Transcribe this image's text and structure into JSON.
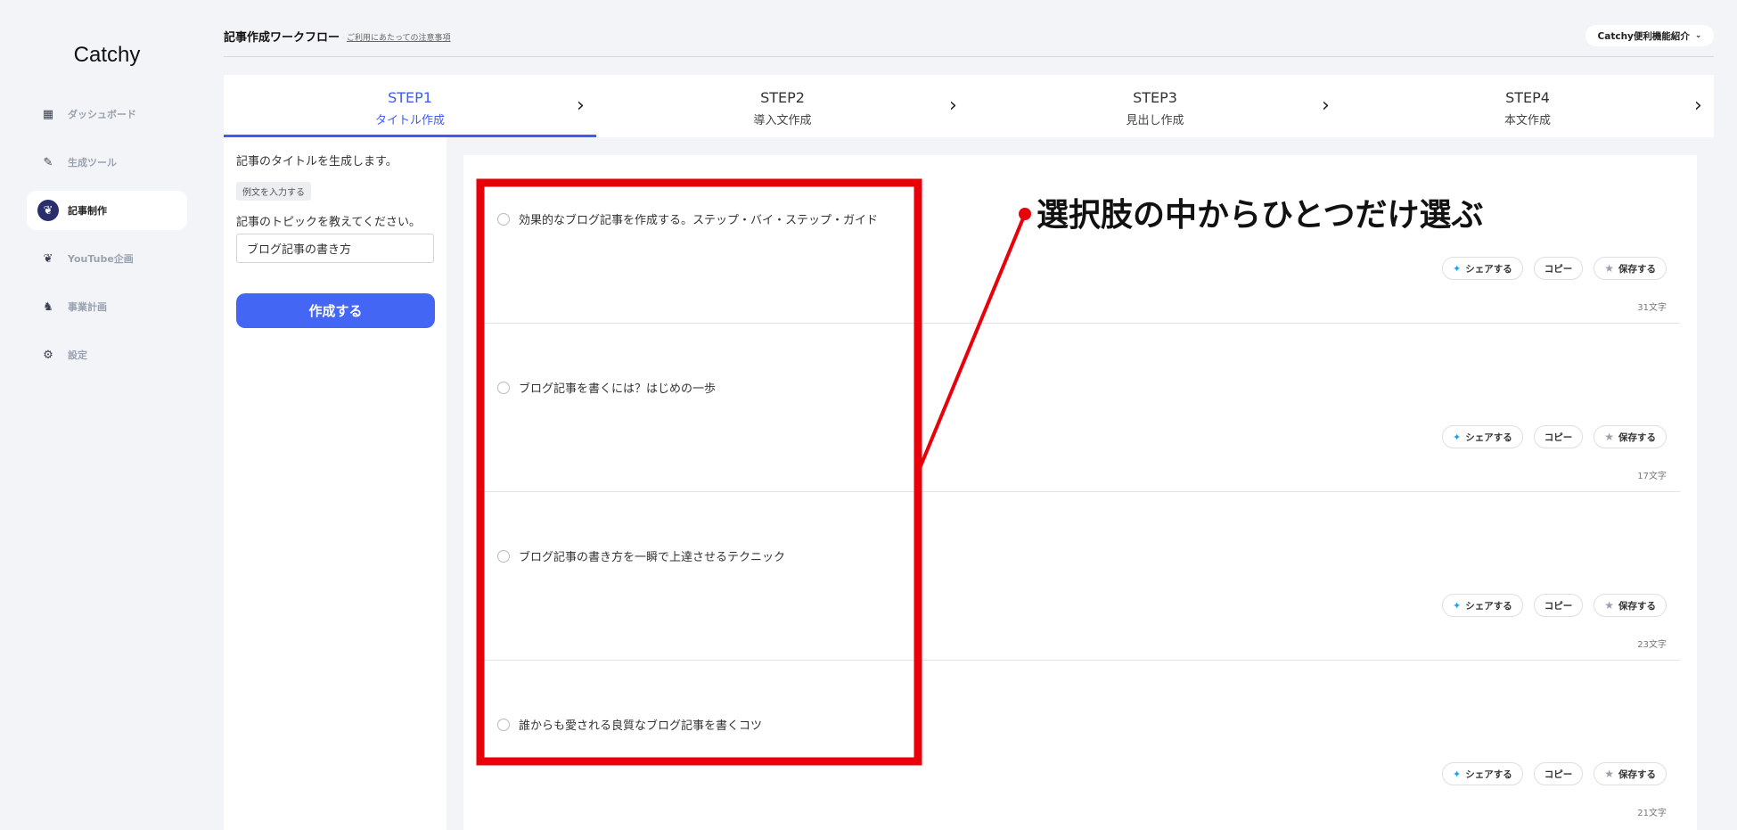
{
  "sidebar": {
    "logo": "Catchy",
    "items": [
      {
        "label": "ダッシュボード",
        "icon": "grid-icon",
        "active": false
      },
      {
        "label": "生成ツール",
        "icon": "pen-icon",
        "active": false
      },
      {
        "label": "記事制作",
        "icon": "crow-icon",
        "active": true
      },
      {
        "label": "YouTube企画",
        "icon": "crow-icon",
        "active": false
      },
      {
        "label": "事業計画",
        "icon": "unicorn-icon",
        "active": false
      },
      {
        "label": "設定",
        "icon": "gear-icon",
        "active": false
      }
    ]
  },
  "header": {
    "title": "記事作成ワークフロー",
    "notice_link": "ご利用にあたっての注意事項",
    "feature_button": "Catchy便利機能紹介"
  },
  "steps": [
    {
      "title": "STEP1",
      "subtitle": "タイトル作成",
      "active": true
    },
    {
      "title": "STEP2",
      "subtitle": "導入文作成",
      "active": false
    },
    {
      "title": "STEP3",
      "subtitle": "見出し作成",
      "active": false
    },
    {
      "title": "STEP4",
      "subtitle": "本文作成",
      "active": false
    }
  ],
  "left_panel": {
    "description": "記事のタイトルを生成します。",
    "example_badge": "例文を入力する",
    "topic_label": "記事のトピックを教えてください。",
    "topic_value": "ブログ記事の書き方",
    "create_button": "作成する"
  },
  "results": [
    {
      "text": "効果的なブログ記事を作成する。ステップ・バイ・ステップ・ガイド",
      "count": "31文字"
    },
    {
      "text": "ブログ記事を書くには？はじめの一歩",
      "count": "17文字"
    },
    {
      "text": "ブログ記事の書き方を一瞬で上達させるテクニック",
      "count": "23文字"
    },
    {
      "text": "誰からも愛される良質なブログ記事を書くコツ",
      "count": "21文字"
    }
  ],
  "actions": {
    "share": "シェアする",
    "copy": "コピー",
    "save": "保存する"
  },
  "annotation": {
    "text": "選択肢の中からひとつだけ選ぶ",
    "color": "#e8000a"
  },
  "colors": {
    "accent": "#4466f5",
    "active_nav_icon_bg": "#2a2f6b",
    "background": "#f3f4f7"
  }
}
